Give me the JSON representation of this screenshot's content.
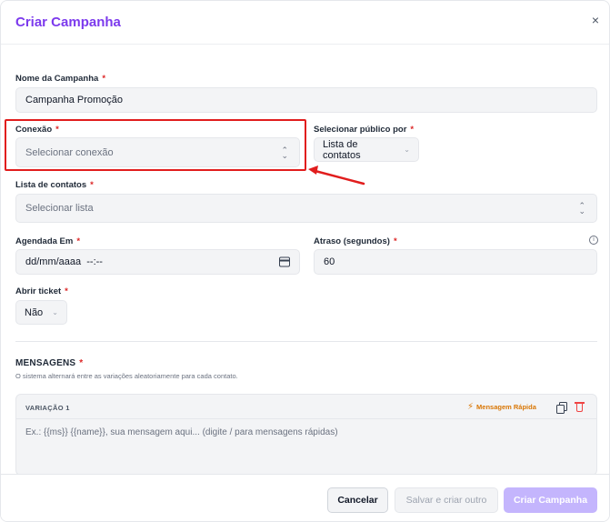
{
  "modal": {
    "title": "Criar Campanha",
    "close_label": "×"
  },
  "form": {
    "required_mark": "*",
    "campaign_name": {
      "label": "Nome da Campanha",
      "value": "Campanha Promoção"
    },
    "connection": {
      "label": "Conexão",
      "placeholder": "Selecionar conexão"
    },
    "audience": {
      "label": "Selecionar público por",
      "value": "Lista de contatos"
    },
    "contact_list": {
      "label": "Lista de contatos",
      "placeholder": "Selecionar lista"
    },
    "scheduled": {
      "label": "Agendada Em",
      "value": "dd/mm/aaaa  --:--"
    },
    "delay": {
      "label": "Atraso (segundos)",
      "value": "60"
    },
    "open_ticket": {
      "label": "Abrir ticket",
      "value": "Não"
    }
  },
  "messages": {
    "title": "MENSAGENS",
    "description": "O sistema alternará entre as variações aleatoriamente para cada contato.",
    "variation": {
      "title": "VARIAÇÃO 1",
      "quick_message_label": "Mensagem Rápida",
      "placeholder": "Ex.: {{ms}} {{name}}, sua mensagem aqui... (digite / para mensagens rápidas)"
    }
  },
  "footer": {
    "cancel_label": "Cancelar",
    "save_label": "Salvar e criar outro",
    "create_label": "Criar Campanha"
  },
  "colors": {
    "accent": "#7c3aed",
    "accent_disabled": "#c4b5fd",
    "required": "#dc2626",
    "quick_message": "#d97706",
    "highlight": "#e11d1d"
  },
  "icons": {
    "close": "close-icon",
    "select_arrows": "updown-arrows-icon",
    "dropdown": "chevron-down-icon",
    "calendar": "calendar-icon",
    "info": "info-icon",
    "bolt": "lightning-icon",
    "copy": "copy-icon",
    "trash": "trash-icon"
  }
}
